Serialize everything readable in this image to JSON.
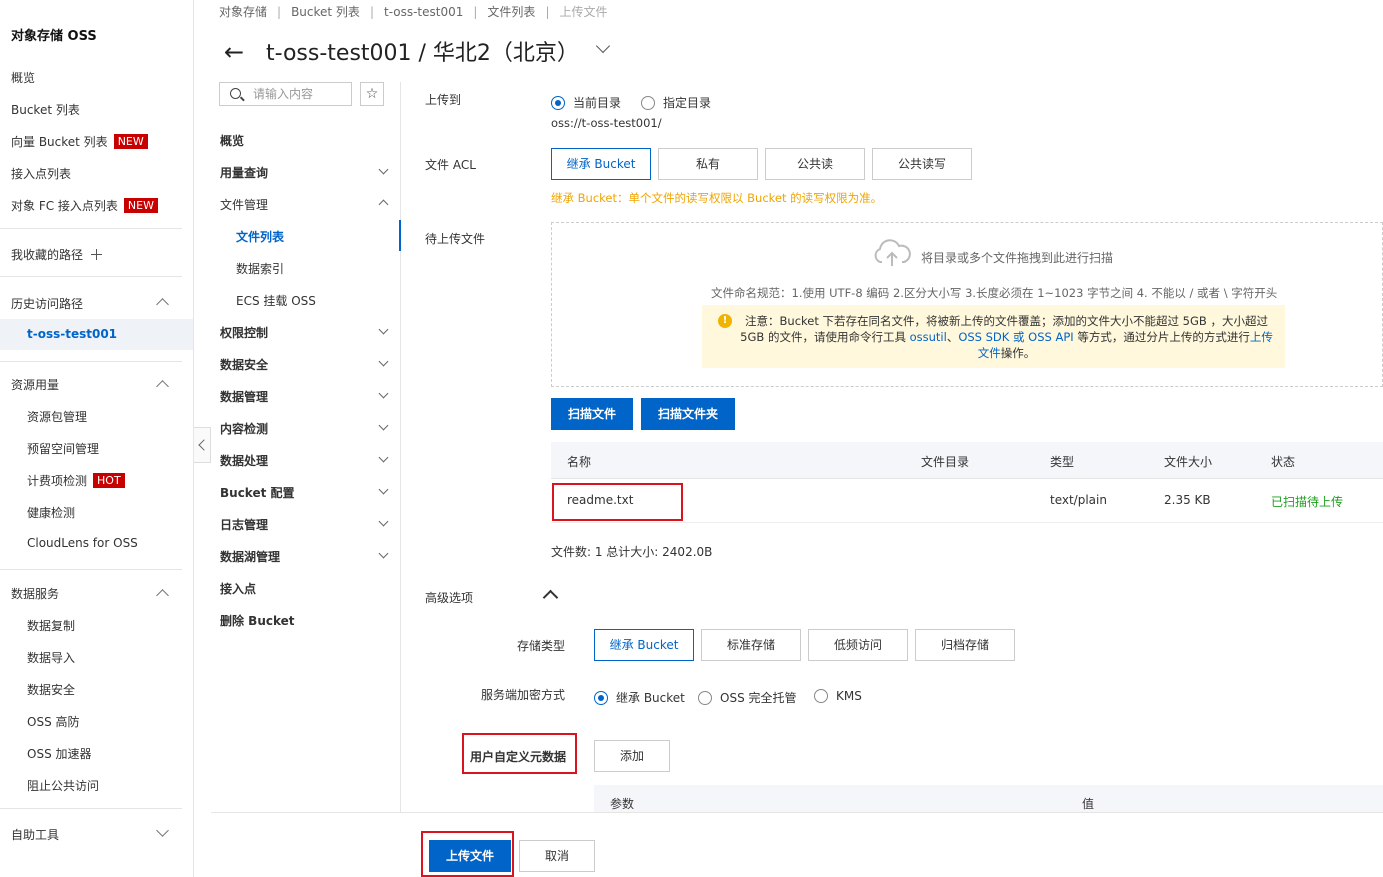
{
  "sidebar": {
    "title": "对象存储 OSS",
    "items": [
      {
        "label": "概览"
      },
      {
        "label": "Bucket 列表"
      },
      {
        "label": "向量 Bucket 列表",
        "badge": "NEW"
      },
      {
        "label": "接入点列表"
      },
      {
        "label": "对象 FC 接入点列表",
        "badge": "NEW"
      }
    ],
    "favorites_label": "我收藏的路径",
    "history": {
      "label": "历史访问路径",
      "items": [
        "t-oss-test001"
      ]
    },
    "resource": {
      "label": "资源用量",
      "items": [
        {
          "label": "资源包管理"
        },
        {
          "label": "预留空间管理"
        },
        {
          "label": "计费项检测",
          "badge": "HOT"
        },
        {
          "label": "健康检测"
        },
        {
          "label": "CloudLens for OSS"
        }
      ]
    },
    "data_services": {
      "label": "数据服务",
      "items": [
        "数据复制",
        "数据导入",
        "数据安全",
        "OSS 高防",
        "OSS 加速器",
        "阻止公共访问"
      ]
    },
    "self_service": {
      "label": "自助工具"
    }
  },
  "breadcrumb": [
    "对象存储",
    "Bucket 列表",
    "t-oss-test001",
    "文件列表",
    "上传文件"
  ],
  "header": {
    "back_icon": "←",
    "title": "t-oss-test001 / 华北2（北京）"
  },
  "secondary_nav": {
    "search_placeholder": "请输入内容",
    "star_icon": "☆",
    "items": {
      "overview": "概览",
      "usage": "用量查询",
      "file_mgmt": "文件管理",
      "file_list": "文件列表",
      "data_index": "数据索引",
      "ecs_mount": "ECS 挂载 OSS",
      "permission": "权限控制",
      "data_security": "数据安全",
      "data_mgmt": "数据管理",
      "content_check": "内容检测",
      "data_process": "数据处理",
      "bucket_config": "Bucket 配置",
      "log_mgmt": "日志管理",
      "lake_mgmt": "数据湖管理",
      "access_point": "接入点",
      "delete_bucket": "删除 Bucket"
    }
  },
  "form": {
    "upload_to": {
      "label": "上传到",
      "options": [
        "当前目录",
        "指定目录"
      ],
      "selected": "当前目录",
      "path": "oss://t-oss-test001/"
    },
    "acl": {
      "label": "文件 ACL",
      "options": [
        "继承 Bucket",
        "私有",
        "公共读",
        "公共读写"
      ],
      "selected": "继承 Bucket",
      "hint": "继承 Bucket：单个文件的读写权限以 Bucket 的读写权限为准。"
    },
    "pending": {
      "label": "待上传文件",
      "drop_hint": "将目录或多个文件拖拽到此进行扫描",
      "naming_rule": "文件命名规范：1.使用 UTF-8 编码 2.区分大小写 3.长度必须在 1~1023 字节之间 4. 不能以 / 或者 \\ 字符开头",
      "notice": {
        "icon": "!",
        "part1": "注意：Bucket 下若存在同名文件，将被新上传的文件覆盖；添加的文件大小不能超过 5GB ，大小超过 5GB 的文件，请使用命令行工具 ",
        "link1": "ossutil",
        "sep1": "、",
        "link2": "OSS SDK",
        "sep2": " 或 ",
        "link3": "OSS API",
        "part2": " 等方式，通过分片上传的方式进行",
        "link4": "上传文件",
        "part3": "操作。"
      },
      "scan_file_button": "扫描文件",
      "scan_folder_button": "扫描文件夹"
    },
    "file_table": {
      "columns": [
        "名称",
        "文件目录",
        "类型",
        "文件大小",
        "状态"
      ],
      "rows": [
        {
          "name": "readme.txt",
          "dir": "",
          "type": "text/plain",
          "size": "2.35 KB",
          "status": "已扫描待上传"
        }
      ],
      "summary": "文件数: 1   总计大小: 2402.0B"
    },
    "advanced": {
      "label": "高级选项",
      "storage_class": {
        "label": "存储类型",
        "options": [
          "继承 Bucket",
          "标准存储",
          "低频访问",
          "归档存储"
        ],
        "selected": "继承 Bucket"
      },
      "encryption": {
        "label": "服务端加密方式",
        "options": [
          "继承 Bucket",
          "OSS 完全托管",
          "KMS"
        ],
        "selected": "继承 Bucket"
      },
      "metadata": {
        "label": "用户自定义元数据",
        "add_button": "添加",
        "columns": [
          "参数",
          "值"
        ]
      }
    }
  },
  "footer": {
    "upload_button": "上传文件",
    "cancel_button": "取消"
  },
  "colors": {
    "primary": "#0064c8",
    "highlight_box": "#d9141e",
    "warning_text": "#f0a500",
    "success": "#1e9e1e"
  }
}
